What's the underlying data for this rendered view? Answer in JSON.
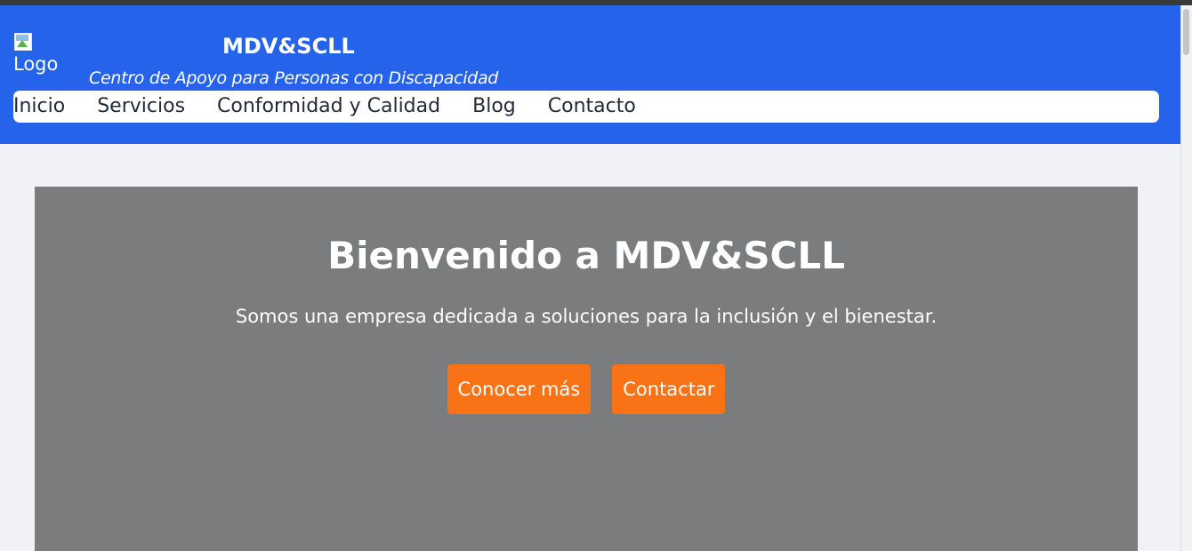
{
  "header": {
    "logo_alt": "Logo",
    "brand_name": "MDV&SCLL",
    "tagline": "Centro de Apoyo para Personas con Discapacidad",
    "background_color": "#2563eb"
  },
  "nav": {
    "items": [
      {
        "label": "Inicio"
      },
      {
        "label": "Servicios"
      },
      {
        "label": "Conformidad y Calidad"
      },
      {
        "label": "Blog"
      },
      {
        "label": "Contacto"
      }
    ]
  },
  "hero": {
    "title": "Bienvenido a MDV&SCLL",
    "subtitle": "Somos una empresa dedicada a soluciones para la inclusión y el bienestar.",
    "buttons": {
      "learn_more": "Conocer más",
      "contact": "Contactar"
    },
    "background_color": "#7b7c7e",
    "button_color": "#f97316"
  },
  "icons": {
    "logo_image": "broken-image-icon"
  }
}
